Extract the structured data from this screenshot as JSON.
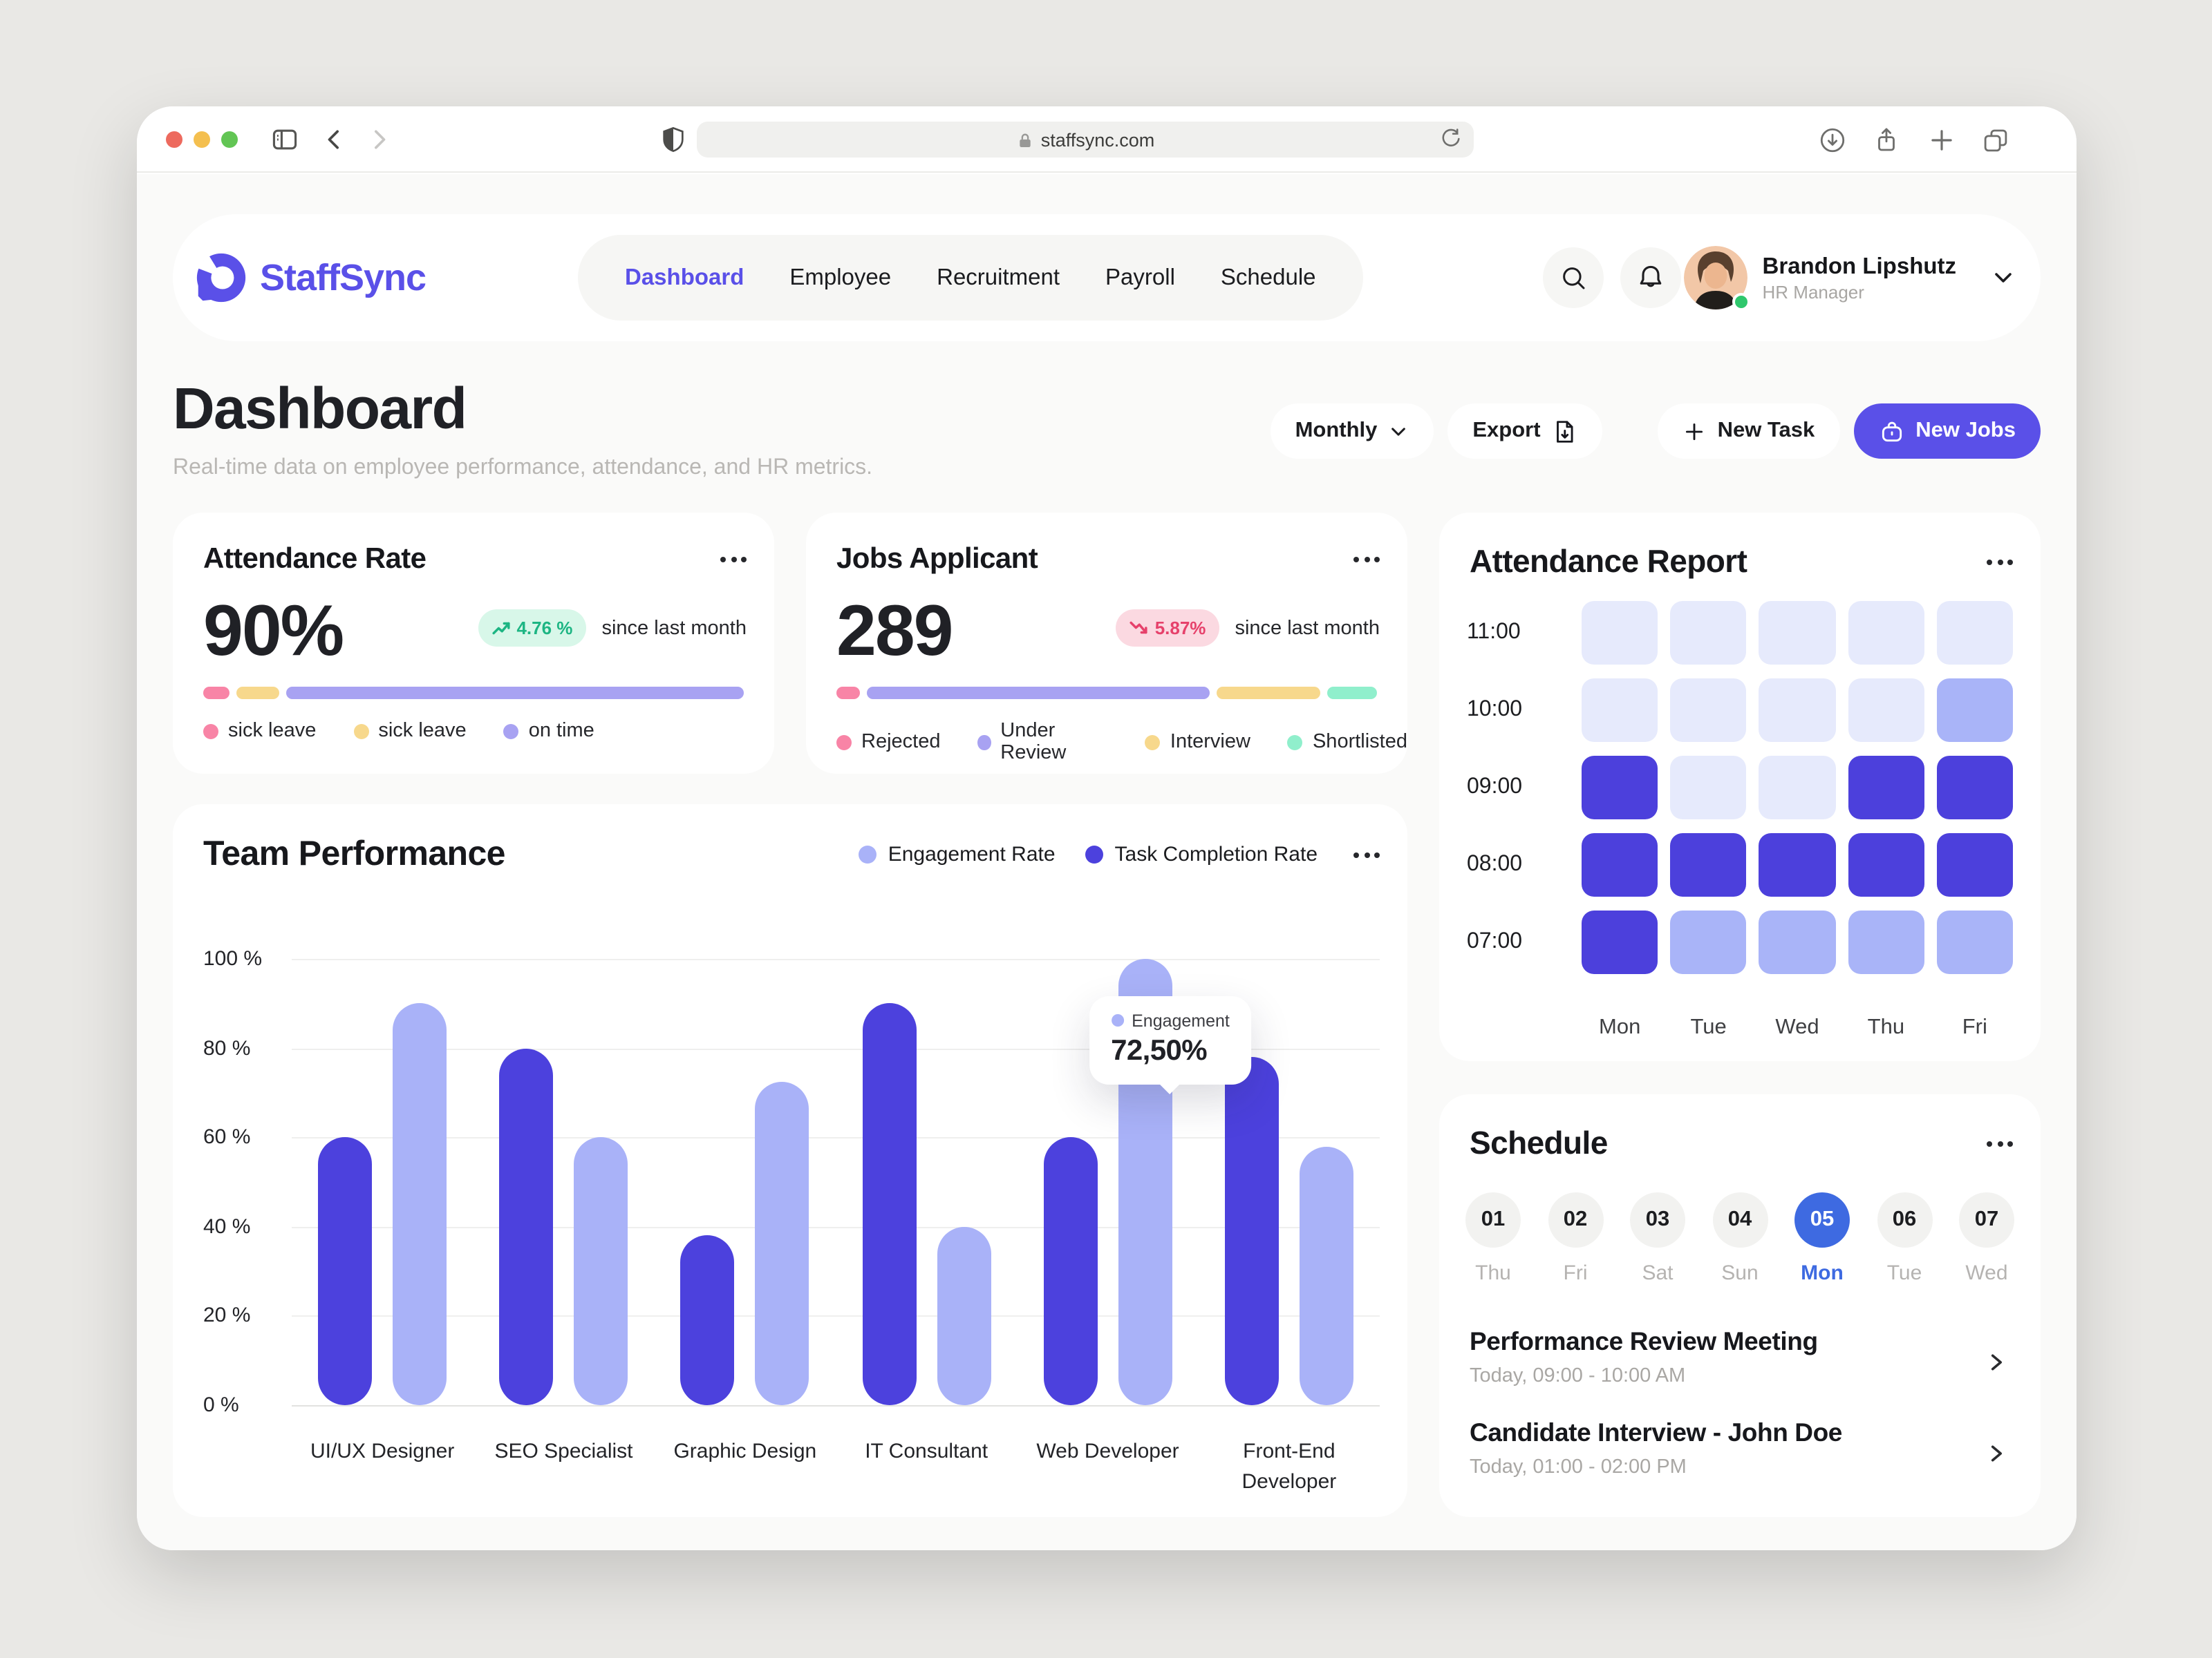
{
  "browser": {
    "url": "staffsync.com"
  },
  "brand": {
    "name": "StaffSync"
  },
  "nav": {
    "items": [
      {
        "label": "Dashboard",
        "active": true
      },
      {
        "label": "Employee",
        "active": false
      },
      {
        "label": "Recruitment",
        "active": false
      },
      {
        "label": "Payroll",
        "active": false
      },
      {
        "label": "Schedule",
        "active": false
      }
    ]
  },
  "user": {
    "name": "Brandon Lipshutz",
    "role": "HR Manager"
  },
  "page": {
    "title": "Dashboard",
    "subtitle": "Real-time data on employee performance, attendance, and HR metrics."
  },
  "toolbar": {
    "period": "Monthly",
    "export_label": "Export",
    "new_task_label": "New Task",
    "new_jobs_label": "New Jobs"
  },
  "colors": {
    "brand": "#5a50e8",
    "selected_day_blue": "#3e6ae1",
    "bar_dark": "#4c41dd",
    "bar_light": "#a9b2f8",
    "up_badge": "#1db583",
    "down_badge": "#e6416b"
  },
  "stats": [
    {
      "title": "Attendance Rate",
      "value": "90%",
      "delta": "4.76 %",
      "delta_direction": "up",
      "delta_note": "since last month",
      "segments": [
        {
          "color": "#f884a6",
          "pct": 5
        },
        {
          "color": "#f7d88c",
          "pct": 8
        },
        {
          "color": "#a8a2f2",
          "pct": 87
        }
      ],
      "legend": [
        {
          "color": "#f884a6",
          "label": "sick leave"
        },
        {
          "color": "#f7d88c",
          "label": "sick leave"
        },
        {
          "color": "#a8a2f2",
          "label": "on time"
        }
      ]
    },
    {
      "title": "Jobs Applicant",
      "value": "289",
      "delta": "5.87%",
      "delta_direction": "down",
      "delta_note": "since last month",
      "segments": [
        {
          "color": "#f884a6",
          "pct": 4.5
        },
        {
          "color": "#a8a2f2",
          "pct": 66
        },
        {
          "color": "#f7d88c",
          "pct": 20
        },
        {
          "color": "#90efcc",
          "pct": 9.5
        }
      ],
      "legend": [
        {
          "color": "#f884a6",
          "label": "Rejected"
        },
        {
          "color": "#a8a2f2",
          "label": "Under Review"
        },
        {
          "color": "#f7d88c",
          "label": "Interview"
        },
        {
          "color": "#90efcc",
          "label": "Shortlisted"
        }
      ]
    }
  ],
  "chart_data": [
    {
      "type": "bar",
      "title": "Team Performance",
      "categories": [
        "UI/UX Designer",
        "SEO Specialist",
        "Graphic Design",
        "IT Consultant",
        "Web Developer",
        "Front-End Developer"
      ],
      "series": [
        {
          "name": "Engagement Rate",
          "color": "#a9b2f8",
          "values": [
            90,
            60,
            72.5,
            40,
            100,
            58
          ]
        },
        {
          "name": "Task Completion Rate",
          "color": "#4c41dd",
          "values": [
            60,
            80,
            38,
            90,
            60,
            78
          ]
        }
      ],
      "ylim": [
        0,
        100
      ],
      "yticks": [
        "100 %",
        "80 %",
        "60 %",
        "40 %",
        "20 %",
        "0 %"
      ],
      "grid": true,
      "legend_position": "top-right",
      "tooltip": {
        "category": "Graphic Design",
        "series_label": "Engagement",
        "value": "72,50%"
      }
    },
    {
      "type": "heatmap",
      "title": "Attendance Report",
      "rows": [
        "11:00",
        "10:00",
        "09:00",
        "08:00",
        "07:00"
      ],
      "cols": [
        "Mon",
        "Tue",
        "Wed",
        "Thu",
        "Fri"
      ],
      "levels": {
        "low": "#e6eafc",
        "medium": "#a9b4f8",
        "high": "#4c40dc"
      },
      "values": [
        [
          "low",
          "low",
          "low",
          "low",
          "low"
        ],
        [
          "low",
          "low",
          "low",
          "low",
          "medium"
        ],
        [
          "high",
          "low",
          "low",
          "high",
          "high"
        ],
        [
          "high",
          "high",
          "high",
          "high",
          "high"
        ],
        [
          "high",
          "medium",
          "medium",
          "medium",
          "medium"
        ]
      ]
    }
  ],
  "schedule": {
    "title": "Schedule",
    "days": [
      {
        "date": "01",
        "day": "Thu",
        "selected": false
      },
      {
        "date": "02",
        "day": "Fri",
        "selected": false
      },
      {
        "date": "03",
        "day": "Sat",
        "selected": false
      },
      {
        "date": "04",
        "day": "Sun",
        "selected": false
      },
      {
        "date": "05",
        "day": "Mon",
        "selected": true
      },
      {
        "date": "06",
        "day": "Tue",
        "selected": false
      },
      {
        "date": "07",
        "day": "Wed",
        "selected": false
      }
    ],
    "events": [
      {
        "title": "Performance Review Meeting",
        "time": "Today, 09:00 - 10:00 AM"
      },
      {
        "title": "Candidate Interview - John Doe",
        "time": "Today, 01:00 - 02:00 PM"
      }
    ]
  }
}
